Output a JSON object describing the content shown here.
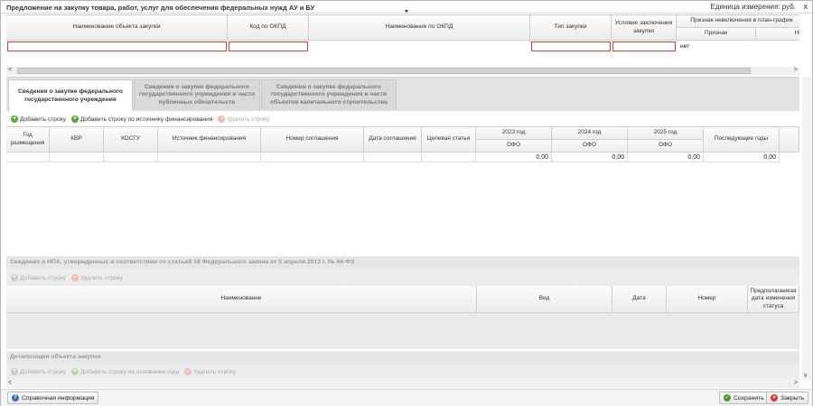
{
  "window": {
    "title": "Предложение на закупку товара, работ, услуг для обеспечения федеральных нужд АУ и БУ",
    "units": "Единица измерения: руб.",
    "close_glyph": "x"
  },
  "top_grid": {
    "headers": {
      "name": "Наименование объекта закупки",
      "okpd_code": "Код по ОКПД",
      "okpd_name": "Наименование по ОКПД",
      "purchase_type": "Тип закупки",
      "condition": "Условие заключения закупки",
      "exclusion_group": "Признак невключения в план-график",
      "sign": "Признак",
      "np": "НП"
    },
    "row": {
      "sign_value": "нет"
    }
  },
  "tabs": [
    {
      "label": "Сведения о закупке федерального государственного учреждения",
      "active": true
    },
    {
      "label": "Сведения о закупке федерального государственного учреждения в части публичных обязательств",
      "active": false
    },
    {
      "label": "Сведения о закупке федерального государственного учреждения в части объектов капитального строительства",
      "active": false
    }
  ],
  "toolbar_main": {
    "add_row": "Добавить строку",
    "add_row_source": "Добавить строку по источнику финансирования",
    "delete_row": "Удалить строку"
  },
  "main_table": {
    "headers": {
      "year": "Год размещения",
      "kvr": "КВР",
      "kosgu": "КОСГУ",
      "source": "Источник финансирования",
      "agreement_no": "Номер соглашения",
      "agreement_date": "Дата соглашения",
      "target": "Целевая статья",
      "y2023": "2023 год",
      "y2024": "2024 год",
      "y2025": "2025 год",
      "next_years": "Последующие годы",
      "ofo": "ОФО"
    },
    "totals": {
      "y2023": "0,00",
      "y2024": "0,00",
      "y2025": "0,00",
      "next_years": "0,00"
    }
  },
  "npa_section": {
    "title": "Сведения о НПА, утвержденных в соответствии со статьей 19 Федерального закона от 5 апреля 2013 г. № 44-ФЗ",
    "toolbar": {
      "add_row": "Добавить строку",
      "delete_row": "Удалить строку"
    },
    "headers": {
      "name": "Наименование",
      "kind": "Вид",
      "date": "Дата",
      "number": "Номер",
      "expected_date": "Предполагаемая дата изменения статуса"
    }
  },
  "detail_section": {
    "title": "Детализация объекта закупки",
    "toolbar": {
      "add_row": "Добавить строку",
      "add_row_basis": "Добавить строку на основании года",
      "delete_row": "Удалить строку"
    }
  },
  "footer": {
    "help": "Справочная информация",
    "save": "Сохранить",
    "close": "Закрыть"
  },
  "colors": {
    "error_border": "#e23b3b",
    "add_icon": "#5aa63c",
    "delete_icon": "#e07b6e",
    "tab_inactive_text": "#7a7a7a"
  }
}
